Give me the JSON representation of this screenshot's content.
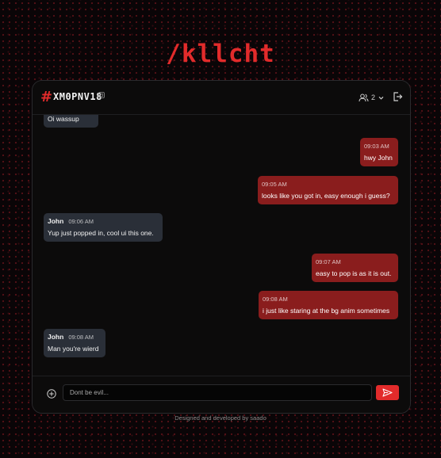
{
  "app": {
    "logo": "/kllcht"
  },
  "header": {
    "hash": "#",
    "room_code": "XM0PNV18",
    "user_count": "2"
  },
  "messages": [
    {
      "dir": "in",
      "author": "",
      "time": "",
      "text": "Oi wassup"
    },
    {
      "dir": "out",
      "author": "",
      "time": "09:03 AM",
      "text": "hwy John"
    },
    {
      "dir": "out",
      "author": "",
      "time": "09:05 AM",
      "text": "looks like you got in, easy enough i guess?"
    },
    {
      "dir": "in",
      "author": "John",
      "time": "09:06 AM",
      "text": "Yup just popped in, cool ui this one."
    },
    {
      "dir": "out",
      "author": "",
      "time": "09:07 AM",
      "text": "easy to pop is as it is out."
    },
    {
      "dir": "out",
      "author": "",
      "time": "09:08 AM",
      "text": "i just like staring at the bg anim sometimes"
    },
    {
      "dir": "in",
      "author": "John",
      "time": "09:08 AM",
      "text": "Man you're wierd"
    }
  ],
  "composer": {
    "placeholder": "Dont be evil..."
  },
  "footer": {
    "credit": "Designed and developed by saado"
  },
  "colors": {
    "accent": "#e22b2b",
    "outgoing": "#8a1d1d",
    "incoming": "#2a2f38"
  }
}
